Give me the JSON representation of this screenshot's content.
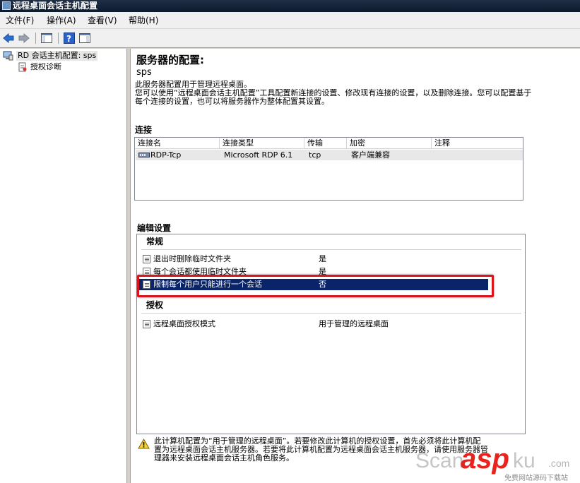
{
  "window": {
    "title": "远程桌面会话主机配置"
  },
  "menu": [
    {
      "label": "文件(F)"
    },
    {
      "label": "操作(A)"
    },
    {
      "label": "查看(V)"
    },
    {
      "label": "帮助(H)"
    }
  ],
  "tree": {
    "root_label": "RD 会话主机配置: sps",
    "child_label": "授权诊断"
  },
  "main": {
    "title": "服务器的配置:",
    "server_name": "sps",
    "description_lines": [
      "此服务器配置用于管理远程桌面。",
      "您可以使用“远程桌面会话主机配置”工具配置新连接的设置、修改现有连接的设置，以及删除连接。您可以配置基于",
      "每个连接的设置，也可以将服务器作为整体配置其设置。"
    ]
  },
  "connections": {
    "heading": "连接",
    "columns": [
      "连接名",
      "连接类型",
      "传输",
      "加密",
      "注释"
    ],
    "rows": [
      {
        "name": "RDP-Tcp",
        "type": "Microsoft RDP 6.1",
        "transport": "tcp",
        "encryption": "客户端兼容",
        "comment": ""
      }
    ]
  },
  "settings": {
    "heading": "编辑设置",
    "groups": [
      {
        "name": "常规",
        "items": [
          {
            "label": "退出时删除临时文件夹",
            "value": "是"
          },
          {
            "label": "每个会话都使用临时文件夹",
            "value": "是"
          },
          {
            "label": "限制每个用户只能进行一个会话",
            "value": "否"
          }
        ]
      },
      {
        "name": "授权",
        "items": [
          {
            "label": "远程桌面授权模式",
            "value": "用于管理的远程桌面"
          }
        ]
      }
    ]
  },
  "warning": {
    "lines": [
      "此计算机配置为“用于管理的远程桌面”。若要修改此计算机的授权设置，首先必须将此计算机配",
      "置为远程桌面会话主机服务器。若要将此计算机配置为远程桌面会话主机服务器，请使用服务器管",
      "理器来安装远程桌面会话主机角色服务。"
    ]
  },
  "watermark": {
    "brand_left": "Scan",
    "brand_mid": "asp",
    "brand_right": "ku",
    "domain_suffix": ".com",
    "tagline": "免费网站源码下载站"
  },
  "colors": {
    "selection": "#0a246a",
    "highlight_border": "#d9141b",
    "watermark_red": "#e8231b"
  }
}
